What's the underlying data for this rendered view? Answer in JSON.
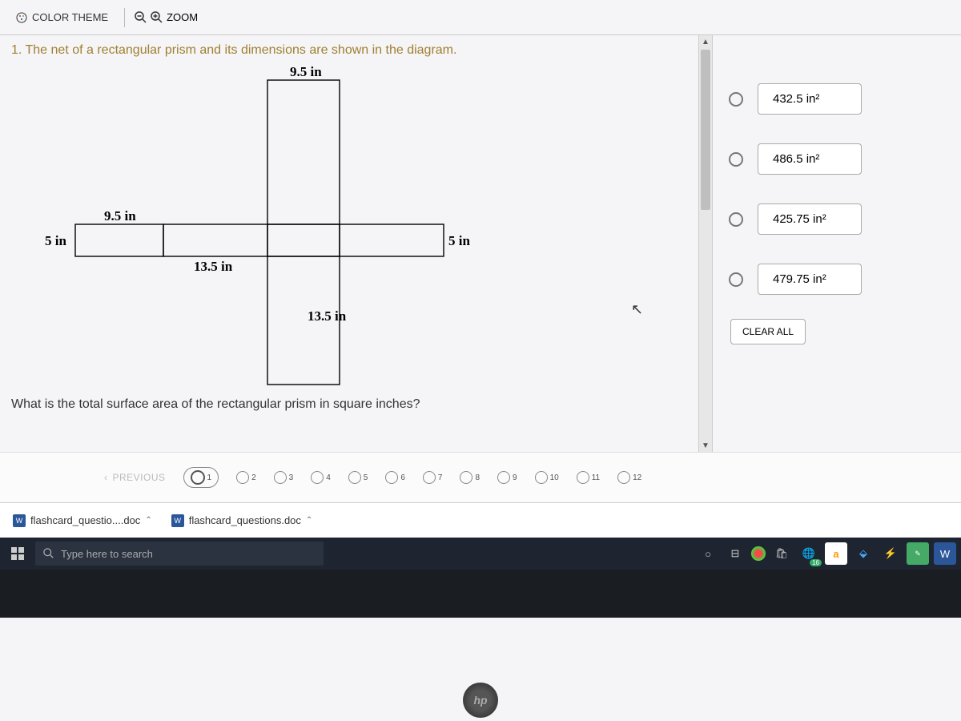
{
  "toolbar": {
    "color_theme": "COLOR THEME",
    "zoom": "ZOOM"
  },
  "question": {
    "number_text": "1. The net of a rectangular prism and its dimensions are shown in the diagram.",
    "sub_text": "What is the total surface area of the rectangular prism in square inches?"
  },
  "diagram": {
    "dims": {
      "top_width": "9.5 in",
      "left_width": "9.5 in",
      "left_height": "5 in",
      "right_height": "5 in",
      "bottom_left_length": "13.5 in",
      "lower_length": "13.5 in"
    }
  },
  "answers": {
    "a": "432.5 in²",
    "b": "486.5 in²",
    "c": "425.75 in²",
    "d": "479.75 in²",
    "clear": "CLEAR ALL"
  },
  "pagination": {
    "previous": "PREVIOUS",
    "pages": [
      "1",
      "2",
      "3",
      "4",
      "5",
      "6",
      "7",
      "8",
      "9",
      "10",
      "11",
      "12"
    ],
    "current": 1
  },
  "downloads": {
    "file1": "flashcard_questio....doc",
    "file2": "flashcard_questions.doc"
  },
  "taskbar": {
    "search_placeholder": "Type here to search",
    "edge_badge": "16"
  },
  "hp": "hp"
}
